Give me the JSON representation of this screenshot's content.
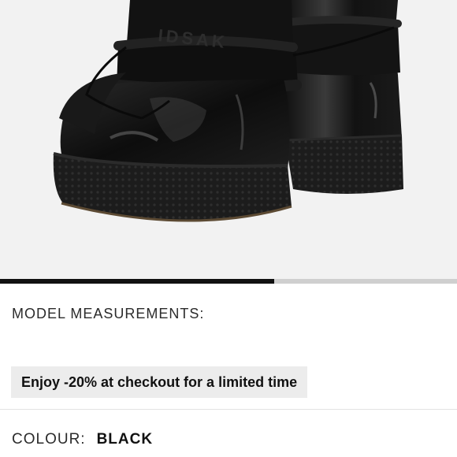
{
  "product": {
    "image_alt": "Black patent leather snow boots with shearling trim and lace-up cord",
    "brand_mark": "IDSAK",
    "carousel_progress": 0.6
  },
  "details": {
    "model_measurements_label": "MODEL MEASUREMENTS:"
  },
  "promo": {
    "text": "Enjoy -20% at checkout for a limited time"
  },
  "colour": {
    "label": "COLOUR:",
    "value": "BLACK"
  },
  "colors": {
    "image_background": "#f2f2f2",
    "promo_background": "#ececec",
    "progress_fill": "#111111",
    "progress_track": "#cfcfcf"
  }
}
